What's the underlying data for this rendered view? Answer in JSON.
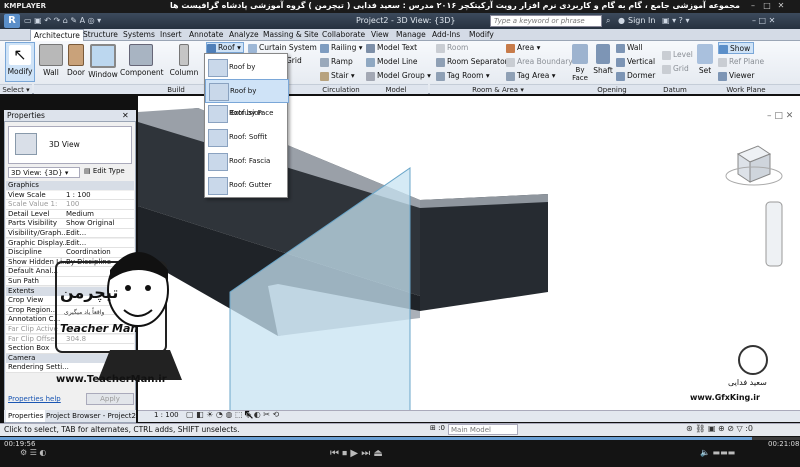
{
  "player": {
    "logo": "KMPLAYER",
    "title": "مجموعه آموزشی جامع ، گام به گام و کاربردی نرم افزار رویت آرکیتکچر ۲۰۱۶  مدرس : سعید فدایی ( تیچرمن ) گروه آموزشی پادشاه گرافیست ها",
    "time_elapsed": "00:19:56",
    "time_total": "00:21:08"
  },
  "app": {
    "logo_letter": "R",
    "doc_title": "Project2 - 3D View: {3D}",
    "search_placeholder": "Type a keyword or phrase",
    "sign_in": "Sign In"
  },
  "tabs": [
    "Architecture",
    "Structure",
    "Systems",
    "Insert",
    "Annotate",
    "Analyze",
    "Massing & Site",
    "Collaborate",
    "View",
    "Manage",
    "Add-Ins",
    "Modify"
  ],
  "ribbon": {
    "modify": "Modify",
    "select": "Select",
    "build": {
      "label": "Build",
      "wall": "Wall",
      "door": "Door",
      "window": "Window",
      "component": "Component",
      "column": "Column",
      "roof": "Roof",
      "curtain_system": "Curtain System",
      "grid": "Grid"
    },
    "circulation": {
      "label": "Circulation",
      "railing": "Railing",
      "ramp": "Ramp",
      "stair": "Stair"
    },
    "model": {
      "label": "Model",
      "text": "Model Text",
      "line": "Model Line",
      "group": "Model Group"
    },
    "room": {
      "label": "Room & Area",
      "room": "Room",
      "separator": "Room Separator",
      "tag_room": "Tag Room",
      "area": "Area",
      "area_boundary": "Area Boundary",
      "tag_area": "Tag Area"
    },
    "opening": {
      "label": "Opening",
      "by_face": "By Face",
      "shaft": "Shaft",
      "wall": "Wall",
      "vertical": "Vertical",
      "dormer": "Dormer"
    },
    "datum": {
      "label": "Datum",
      "level": "Level",
      "grid": "Grid"
    },
    "work_plane": {
      "label": "Work Plane",
      "set": "Set",
      "show": "Show",
      "ref_plane": "Ref Plane",
      "viewer": "Viewer"
    }
  },
  "roof_menu": [
    "Roof by Footprint",
    "Roof by Extrusion",
    "Roof by Face",
    "Roof: Soffit",
    "Roof: Fascia",
    "Roof: Gutter"
  ],
  "properties": {
    "title": "Properties",
    "type": "3D View",
    "instance": "3D View: {3D}",
    "edit_type": "Edit Type",
    "rows": [
      {
        "k": "Graphics",
        "v": "",
        "cat": true
      },
      {
        "k": "View Scale",
        "v": "1 : 100"
      },
      {
        "k": "Scale Value    1:",
        "v": "100",
        "gray": true
      },
      {
        "k": "Detail Level",
        "v": "Medium"
      },
      {
        "k": "Parts Visibility",
        "v": "Show Original"
      },
      {
        "k": "Visibility/Graph...",
        "v": "Edit..."
      },
      {
        "k": "Graphic Display...",
        "v": "Edit..."
      },
      {
        "k": "Discipline",
        "v": "Coordination"
      },
      {
        "k": "Show Hidden Li...",
        "v": "By Discipline"
      },
      {
        "k": "Default Anal...",
        "v": ""
      },
      {
        "k": "Sun Path",
        "v": ""
      },
      {
        "k": "Extents",
        "v": "",
        "cat": true
      },
      {
        "k": "Crop View",
        "v": ""
      },
      {
        "k": "Crop Region...",
        "v": ""
      },
      {
        "k": "Annotation C...",
        "v": ""
      },
      {
        "k": "Far Clip Active",
        "v": "",
        "gray": true
      },
      {
        "k": "Far Clip Offset",
        "v": "304.8",
        "gray": true
      },
      {
        "k": "Section Box",
        "v": ""
      },
      {
        "k": "Camera",
        "v": "",
        "cat": true
      },
      {
        "k": "Rendering Setti...",
        "v": ""
      }
    ],
    "help": "Properties help",
    "apply": "Apply"
  },
  "browser_tabs": [
    "Properties",
    "Project Browser - Project2"
  ],
  "view_scale": "1 : 100",
  "status": "Click to select, TAB for alternates, CTRL adds, SHIFT unselects.",
  "workset": "Main Model",
  "status_count": ":0",
  "overlay": {
    "brand_fa": "تیچرمن",
    "brand_en": "Teacher Man",
    "tagline_fa": "واقعاً یاد میگیری",
    "url": "www.TeacherMan.ir",
    "author_fa": "سعید فدایی",
    "gfx": "www.GfxKing.ir"
  },
  "colors": {
    "ribbon_accent": "#5b8fc9",
    "selection": "#cfe3f7",
    "walls": "#2d3238",
    "glass": "#c7e3f2"
  }
}
